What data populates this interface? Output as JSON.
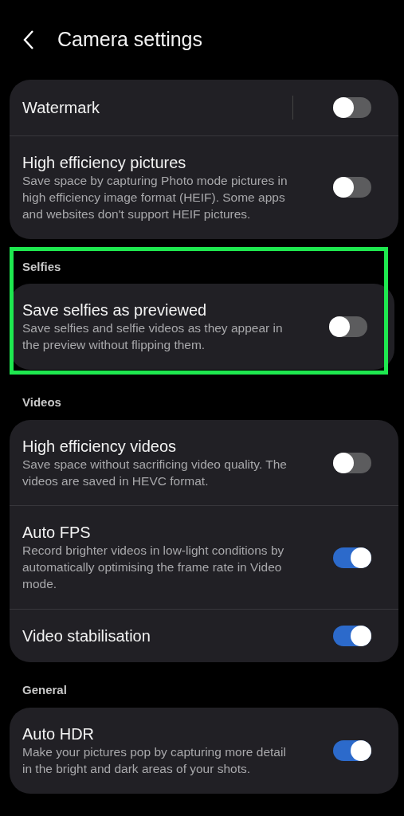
{
  "header": {
    "title": "Camera settings"
  },
  "sections": [
    {
      "highlighted": false,
      "items": [
        {
          "kind": "split",
          "title": "Watermark",
          "on": false
        },
        {
          "kind": "plain",
          "title": "High efficiency pictures",
          "description": "Save space by capturing Photo mode pictures in high efficiency image format (HEIF). Some apps and websites don't support HEIF pictures.",
          "on": false
        }
      ]
    },
    {
      "label": "Selfies",
      "highlighted": true,
      "items": [
        {
          "kind": "plain",
          "title": "Save selfies as previewed",
          "description": "Save selfies and selfie videos as they appear in the preview without flipping them.",
          "on": false
        }
      ]
    },
    {
      "label": "Videos",
      "highlighted": false,
      "items": [
        {
          "kind": "plain",
          "title": "High efficiency videos",
          "description": "Save space without sacrificing video quality. The videos are saved in HEVC format.",
          "on": false
        },
        {
          "kind": "plain",
          "title": "Auto FPS",
          "description": "Record brighter videos in low-light conditions by automatically optimising the frame rate in Video mode.",
          "on": true
        },
        {
          "kind": "plain",
          "title": "Video stabilisation",
          "on": true
        }
      ]
    },
    {
      "label": "General",
      "highlighted": false,
      "items": [
        {
          "kind": "plain",
          "title": "Auto HDR",
          "description": "Make your pictures pop by capturing more detail in the bright and dark areas of your shots.",
          "on": true
        }
      ]
    }
  ]
}
